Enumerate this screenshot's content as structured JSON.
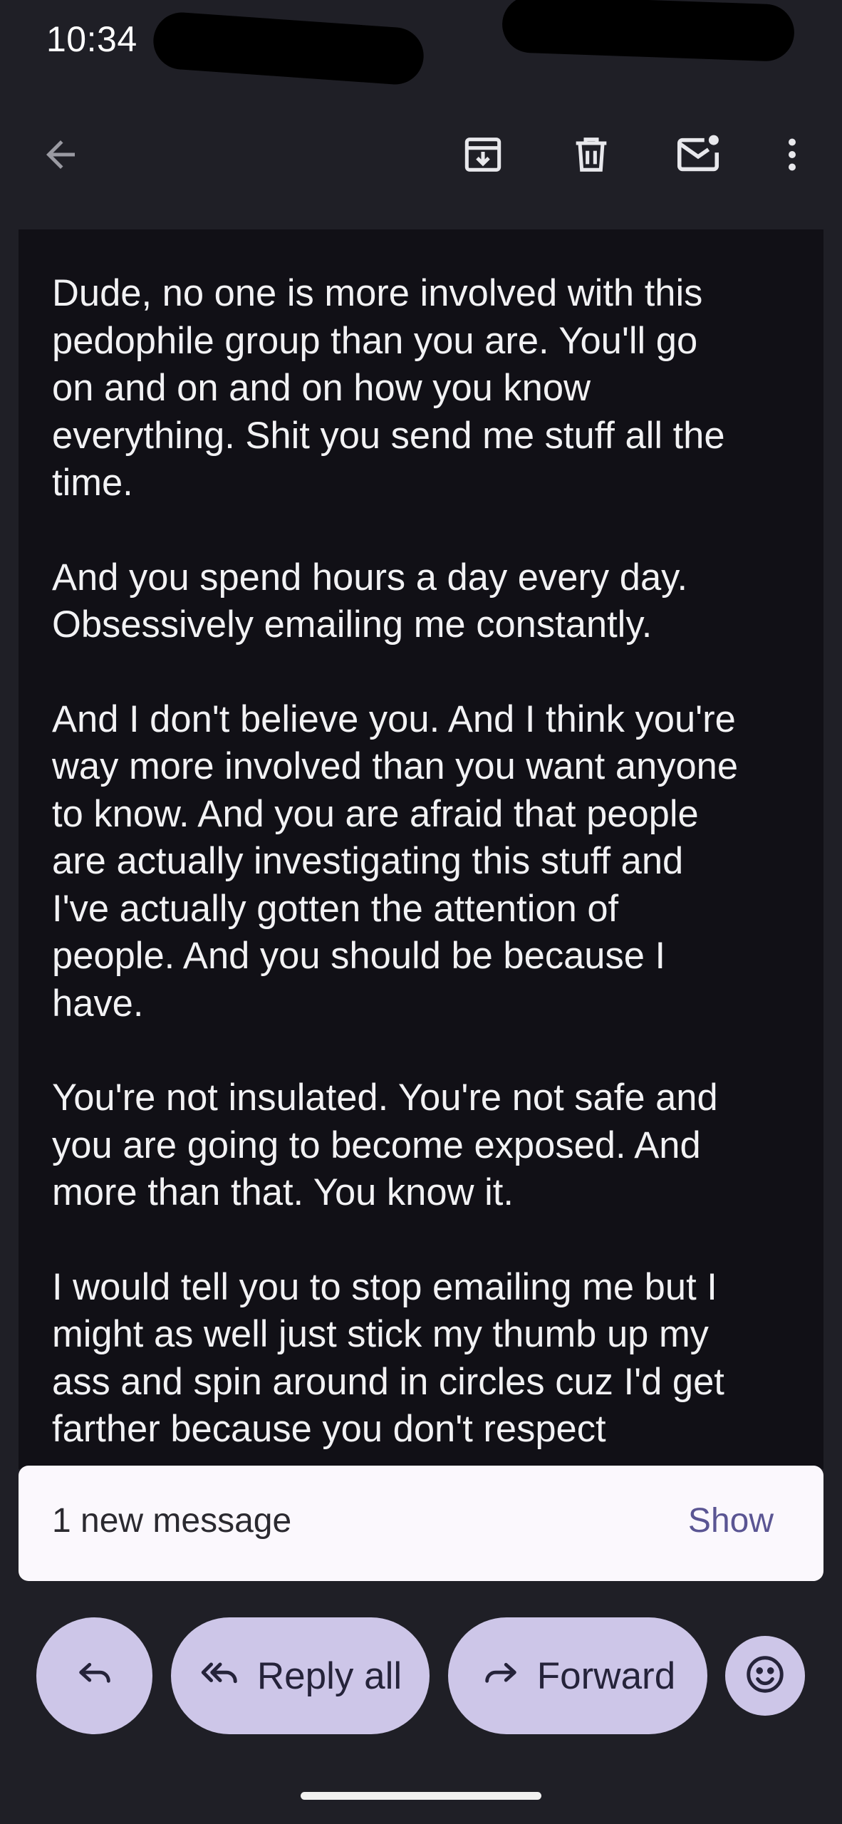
{
  "status_bar": {
    "time": "10:34"
  },
  "toolbar": {
    "back_icon": "arrow-left-icon",
    "archive_icon": "archive-icon",
    "delete_icon": "trash-icon",
    "mark_unread_icon": "mail-unread-icon",
    "more_icon": "more-vert-icon"
  },
  "email": {
    "paragraphs": [
      "Dude, no one is more involved with this\npedophile group than you are. You'll go\non and on and on how you know\neverything. Shit you send me stuff all the\ntime.",
      "And you spend hours a day every day.\nObsessively emailing me constantly.",
      "And I don't believe you. And I think you're\nway more involved than you want anyone\nto know. And you are afraid that people\nare actually investigating this stuff and\nI've actually gotten the attention of\npeople. And you should be because I\nhave.",
      "You're not insulated. You're not safe and\nyou are going to become exposed. And\nmore than that. You know it.",
      "I would tell you to stop emailing me but I\nmight as well just stick my thumb up my\nass and spin around in circles cuz I'd get\nfarther because you don't respect"
    ]
  },
  "snackbar": {
    "message": "1 new message",
    "action": "Show"
  },
  "actions": {
    "reply_icon": "reply-icon",
    "reply_all_label": "Reply all",
    "reply_all_icon": "reply-all-icon",
    "forward_label": "Forward",
    "forward_icon": "forward-icon",
    "emoji_icon": "emoji-reaction-icon"
  },
  "colors": {
    "background": "#1f1f26",
    "body_background": "#111016",
    "pill": "#cdc6e8",
    "snackbar": "#fbf8fd",
    "accent": "#5a5593"
  }
}
